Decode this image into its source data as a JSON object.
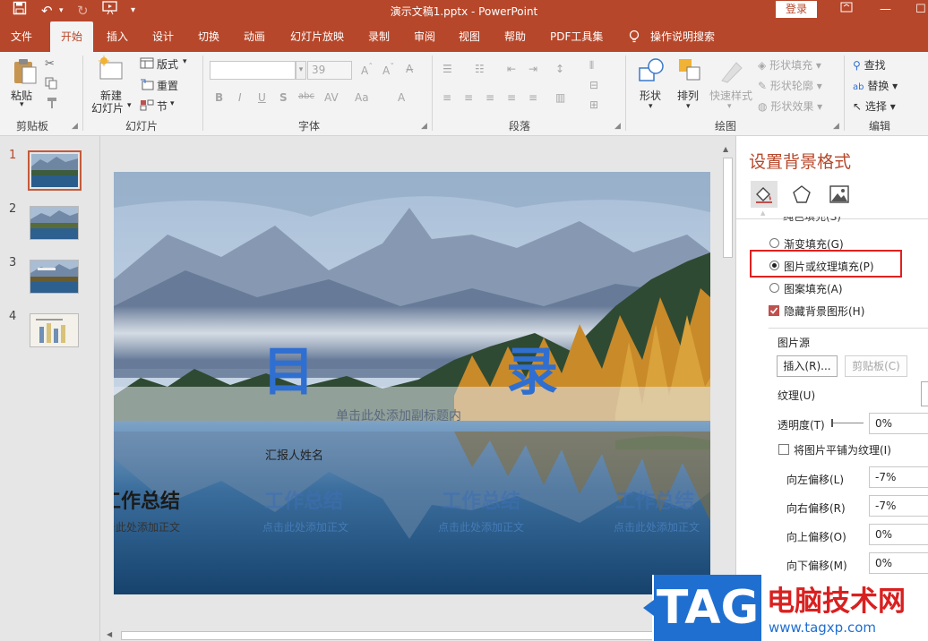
{
  "titlebar": {
    "doc_title": "演示文稿1.pptx  -  PowerPoint",
    "login": "登录"
  },
  "tabs": [
    "文件",
    "开始",
    "插入",
    "设计",
    "切换",
    "动画",
    "幻灯片放映",
    "录制",
    "审阅",
    "视图",
    "帮助",
    "PDF工具集",
    "操作说明搜索"
  ],
  "active_tab": "开始",
  "ribbon": {
    "groups": [
      "剪贴板",
      "幻灯片",
      "字体",
      "段落",
      "绘图",
      "编辑"
    ],
    "clipboard": {
      "paste": "粘贴"
    },
    "slides": {
      "new_slide_line1": "新建",
      "new_slide_line2": "幻灯片",
      "layout": "版式",
      "reset": "重置",
      "section": "节"
    },
    "font": {
      "size": "39",
      "bold": "B",
      "italic": "I",
      "underline": "U",
      "shadow": "S",
      "strike": "abc"
    },
    "drawing": {
      "shape": "形状",
      "arrange": "排列",
      "quick_styles": "快速样式",
      "fill": "形状填充",
      "outline": "形状轮廓",
      "effects": "形状效果"
    },
    "editing": {
      "find": "查找",
      "replace": "替换",
      "select": "选择"
    }
  },
  "thumbnails": [
    {
      "num": "1",
      "selected": true
    },
    {
      "num": "2",
      "selected": false
    },
    {
      "num": "3",
      "selected": false
    },
    {
      "num": "4",
      "selected": false
    }
  ],
  "slide": {
    "title_left": "目",
    "title_right": "录",
    "subtitle": "单击此处添加副标题内",
    "reporter": "汇报人姓名",
    "sections": [
      {
        "title": "工作总结",
        "sub": "击此处添加正文"
      },
      {
        "title": "工作总结",
        "sub": "点击此处添加正文"
      },
      {
        "title": "工作总结",
        "sub": "点击此处添加正文"
      },
      {
        "title": "工作总结",
        "sub": "点击此处添加正文"
      }
    ]
  },
  "pane": {
    "title": "设置背景格式",
    "cut_option": "纯色填充(S)",
    "fill_options": [
      {
        "label": "渐变填充(G)",
        "selected": false
      },
      {
        "label": "图片或纹理填充(P)",
        "selected": true
      },
      {
        "label": "图案填充(A)",
        "selected": false
      }
    ],
    "hide_bg": "隐藏背景图形(H)",
    "hide_bg_checked": true,
    "picture_source": "图片源",
    "insert_btn": "插入(R)...",
    "clipboard_btn": "剪贴板(C)",
    "texture": "纹理(U)",
    "transparency_label": "透明度(T)",
    "transparency_value": "0%",
    "tile_label": "将图片平铺为纹理(I)",
    "tile_checked": false,
    "offsets": [
      {
        "label": "向左偏移(L)",
        "value": "-7%"
      },
      {
        "label": "向右偏移(R)",
        "value": "-7%"
      },
      {
        "label": "向上偏移(O)",
        "value": "0%"
      },
      {
        "label": "向下偏移(M)",
        "value": "0%"
      }
    ]
  },
  "watermark": {
    "logo": "TAG",
    "site_name": "电脑技术网",
    "url": "www.tagxp.com"
  },
  "colors": {
    "brand": "#b7472a",
    "highlight_box": "#e02020",
    "accent_blue": "#2f6fd1"
  }
}
